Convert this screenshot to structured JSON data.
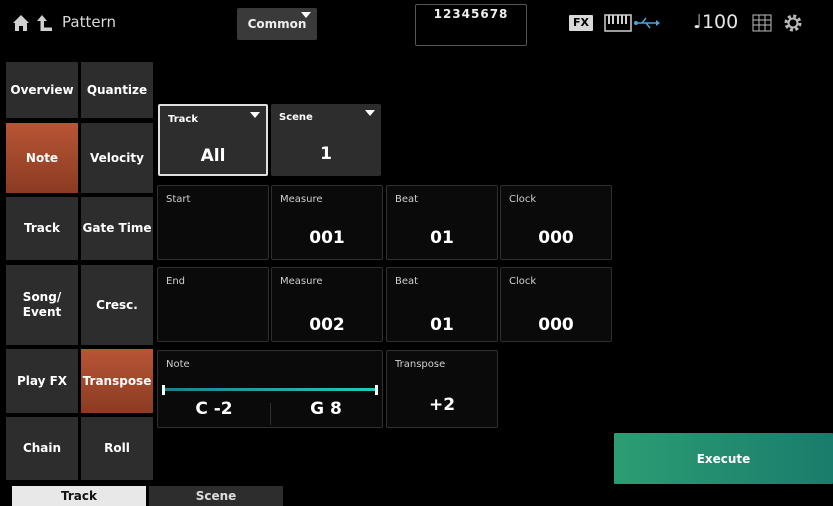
{
  "header": {
    "title": "Pattern",
    "common_label": "Common",
    "track_numbers": "12345678",
    "fx_label": "FX",
    "tempo": "♩100"
  },
  "left_tabs": [
    {
      "label": "Overview"
    },
    {
      "label": "Note"
    },
    {
      "label": "Track"
    },
    {
      "label": "Song/\nEvent"
    },
    {
      "label": "Play FX"
    },
    {
      "label": "Chain"
    }
  ],
  "sub_tabs": [
    {
      "label": "Quantize"
    },
    {
      "label": "Velocity"
    },
    {
      "label": "Gate Time"
    },
    {
      "label": "Cresc."
    },
    {
      "label": "Transpose"
    },
    {
      "label": "Roll"
    }
  ],
  "bottom_tabs": [
    {
      "label": "Track"
    },
    {
      "label": "Scene"
    }
  ],
  "params": {
    "track": {
      "label": "Track",
      "value": "All"
    },
    "scene": {
      "label": "Scene",
      "value": "1"
    },
    "start": {
      "label": "Start",
      "measure_label": "Measure",
      "measure": "001",
      "beat_label": "Beat",
      "beat": "01",
      "clock_label": "Clock",
      "clock": "000"
    },
    "end": {
      "label": "End",
      "measure_label": "Measure",
      "measure": "002",
      "beat_label": "Beat",
      "beat": "01",
      "clock_label": "Clock",
      "clock": "000"
    },
    "note": {
      "label": "Note",
      "low": "C -2",
      "high": "G 8"
    },
    "transpose": {
      "label": "Transpose",
      "value": "+2"
    }
  },
  "execute_label": "Execute"
}
